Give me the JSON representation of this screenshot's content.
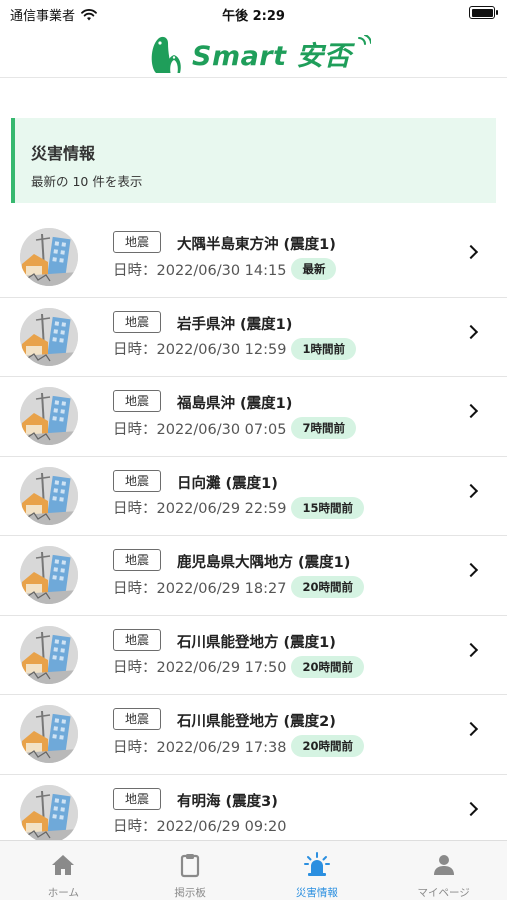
{
  "status_bar": {
    "carrier": "通信事業者",
    "time": "午後 2:29"
  },
  "header": {
    "logo_text": "Smart 安否"
  },
  "info": {
    "title": "災害情報",
    "subtitle": "最新の 10 件を表示"
  },
  "list": {
    "items": [
      {
        "type": "地震",
        "title": "大隅半島東方沖 (震度1)",
        "date": "日時：2022/06/30 14:15",
        "badge": "最新"
      },
      {
        "type": "地震",
        "title": "岩手県沖 (震度1)",
        "date": "日時：2022/06/30 12:59",
        "badge": "1時間前"
      },
      {
        "type": "地震",
        "title": "福島県沖 (震度1)",
        "date": "日時：2022/06/30 07:05",
        "badge": "7時間前"
      },
      {
        "type": "地震",
        "title": "日向灘 (震度1)",
        "date": "日時：2022/06/29 22:59",
        "badge": "15時間前"
      },
      {
        "type": "地震",
        "title": "鹿児島県大隅地方 (震度1)",
        "date": "日時：2022/06/29 18:27",
        "badge": "20時間前"
      },
      {
        "type": "地震",
        "title": "石川県能登地方 (震度1)",
        "date": "日時：2022/06/29 17:50",
        "badge": "20時間前"
      },
      {
        "type": "地震",
        "title": "石川県能登地方 (震度2)",
        "date": "日時：2022/06/29 17:38",
        "badge": "20時間前"
      },
      {
        "type": "地震",
        "title": "有明海 (震度3)",
        "date": "日時：2022/06/29 09:20",
        "badge": ""
      }
    ]
  },
  "tabbar": {
    "tabs": [
      {
        "label": "ホーム",
        "icon": "home-icon"
      },
      {
        "label": "掲示板",
        "icon": "clipboard-icon"
      },
      {
        "label": "災害情報",
        "icon": "alarm-light-icon"
      },
      {
        "label": "マイページ",
        "icon": "person-icon"
      }
    ],
    "active_index": 2
  },
  "colors": {
    "accent_green": "#37b86f",
    "badge_bg": "#d5f3e2",
    "info_bg": "#e8f8ef",
    "tab_active": "#2b8fe0"
  }
}
